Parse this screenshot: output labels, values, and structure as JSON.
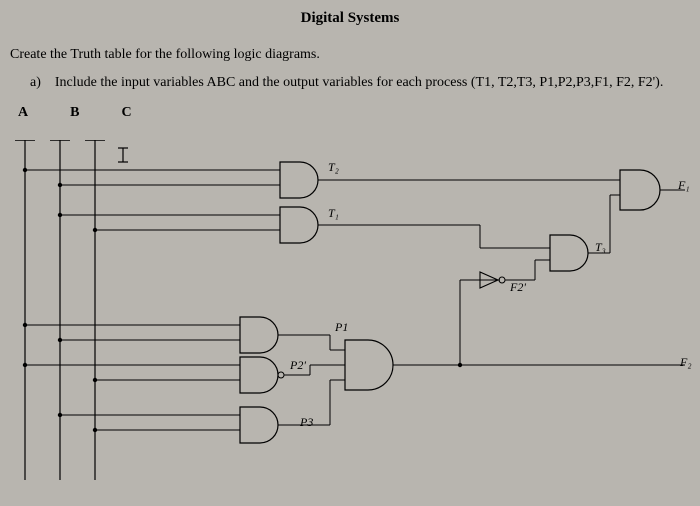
{
  "title": "Digital Systems",
  "instruction": "Create the Truth table for the following logic diagrams.",
  "sub_instruction": "a) Include the input variables ABC and  the output variables for each process (T1, T2,T3, P1,P2,P3,F1, F2, F2').",
  "input_labels": "A B C",
  "labels": {
    "T2": "T₂",
    "T1": "T₁",
    "P1": "P1",
    "P2": "P2'",
    "P3": "P3",
    "F2p": "F2'",
    "T3": "T₃",
    "F1": "F₁",
    "F2": "F₂"
  }
}
